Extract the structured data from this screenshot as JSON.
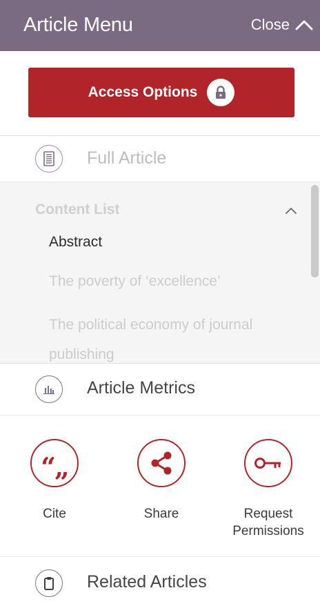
{
  "header": {
    "title": "Article Menu",
    "close_label": "Close"
  },
  "access": {
    "label": "Access Options"
  },
  "full_article": {
    "label": "Full Article"
  },
  "content_list": {
    "title": "Content List",
    "items": [
      {
        "label": "Abstract"
      },
      {
        "label": "The poverty of ‘excellence’"
      },
      {
        "label": "The political economy of journal publishing"
      }
    ]
  },
  "metrics": {
    "label": "Article Metrics"
  },
  "tools": {
    "cite": "Cite",
    "share": "Share",
    "permissions": "Request Permissions"
  },
  "related": {
    "label": "Related Articles"
  },
  "colors": {
    "header_bg": "#7a6b83",
    "accent_red": "#b0242a"
  },
  "icons": {
    "close": "chevron-up-icon",
    "access": "lock-icon",
    "full_article": "document-icon",
    "content_list": "chevron-up-icon",
    "metrics": "bar-chart-icon",
    "cite": "quote-icon",
    "share": "share-icon",
    "permissions": "key-icon",
    "related": "clipboard-icon"
  }
}
